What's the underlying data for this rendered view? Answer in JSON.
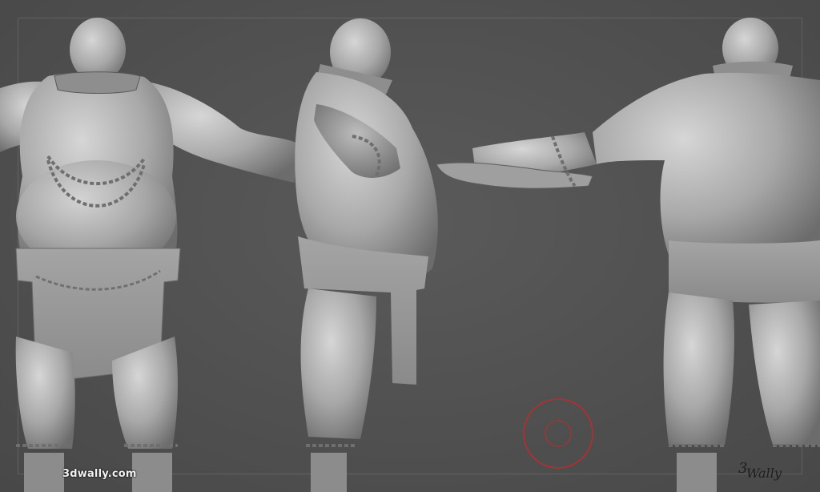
{
  "watermark": {
    "text": "3dwally.com"
  },
  "signature": {
    "text": "3Wally"
  },
  "colors": {
    "background": "#525252",
    "sculpt_clay": "#a9a9a9",
    "cursor_ring": "#c22a2a"
  },
  "views": [
    {
      "name": "front-view"
    },
    {
      "name": "side-view"
    },
    {
      "name": "back-view"
    }
  ],
  "cursor": {
    "icon": "brush-cursor-icon"
  }
}
